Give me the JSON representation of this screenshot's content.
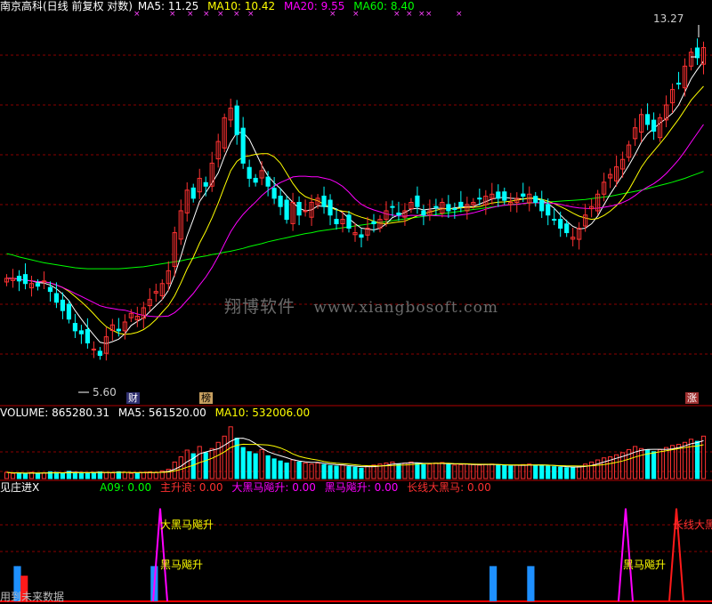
{
  "header": {
    "title": "南京高科(日线 前复权 对数)",
    "ma": [
      {
        "label": "MA5: 11.25",
        "color": "#ffffff"
      },
      {
        "label": "MA10: 10.42",
        "color": "#ffff00"
      },
      {
        "label": "MA20: 9.55",
        "color": "#ff00ff"
      },
      {
        "label": "MA60: 8.40",
        "color": "#00ff00"
      }
    ]
  },
  "volume_header": {
    "items": [
      {
        "label": "VOLUME: 865280.31",
        "color": "#ffffff"
      },
      {
        "label": "MA5: 561520.00",
        "color": "#ffffff"
      },
      {
        "label": "MA10: 532006.00",
        "color": "#ffff00"
      }
    ]
  },
  "indicator_header": {
    "name": "见庄进X",
    "items": [
      {
        "label": "A09: 0.00",
        "color": "#00ff00"
      },
      {
        "label": "主升浪: 0.00",
        "color": "#ff3030"
      },
      {
        "label": "大黑马飚升: 0.00",
        "color": "#ff00ff"
      },
      {
        "label": "黑马飚升: 0.00",
        "color": "#ff00ff"
      },
      {
        "label": "长线大黑马: 0.00",
        "color": "#ff3030"
      }
    ]
  },
  "annotations": {
    "price_high": "13.27",
    "price_low": "5.60",
    "tag_cai": "财",
    "tag_bang": "榜",
    "tag_zhang": "涨",
    "watermark_cn": "翔博软件",
    "watermark_url": "www.xiangbosoft.com",
    "sig_big_dark_horse": "大黑马飚升",
    "sig_dark_horse_left": "黑马飚升",
    "sig_dark_horse_right": "黑马飚升",
    "sig_long_dark_horse": "长线大黑",
    "footer_note": "用到未来数据"
  },
  "colors": {
    "up": "#ff3232",
    "down": "#00ffff",
    "ma5": "#ffffff",
    "ma10": "#ffff00",
    "ma20": "#ff00ff",
    "ma60": "#00ff00",
    "grid": "#8b0000",
    "bar_blue": "#1e90ff"
  },
  "chart_data": [
    {
      "type": "candlestick",
      "ylim": [
        5.0,
        14.5
      ],
      "log_scale": true,
      "closes": [
        6.95,
        6.95,
        6.9,
        6.85,
        6.85,
        6.8,
        6.9,
        6.7,
        6.5,
        6.35,
        6.2,
        6.0,
        5.95,
        5.8,
        5.7,
        5.6,
        5.9,
        6.1,
        6.0,
        6.15,
        6.3,
        6.25,
        6.4,
        6.55,
        6.7,
        6.85,
        7.1,
        7.9,
        8.4,
        8.9,
        8.7,
        9.2,
        9.0,
        9.6,
        10.2,
        10.9,
        11.2,
        10.4,
        9.6,
        9.2,
        9.1,
        9.4,
        9.0,
        8.7,
        8.5,
        8.2,
        8.6,
        8.3,
        8.4,
        8.6,
        8.7,
        8.5,
        8.3,
        8.1,
        8.2,
        8.0,
        7.9,
        7.8,
        8.0,
        8.1,
        8.2,
        8.4,
        8.5,
        8.3,
        8.4,
        8.6,
        8.5,
        8.3,
        8.4,
        8.5,
        8.6,
        8.4,
        8.45,
        8.5,
        8.55,
        8.6,
        8.7,
        8.75,
        8.8,
        8.7,
        8.65,
        8.6,
        8.7,
        8.75,
        8.8,
        8.6,
        8.4,
        8.3,
        8.2,
        8.0,
        7.9,
        7.8,
        8.0,
        8.3,
        8.5,
        8.8,
        9.1,
        9.3,
        9.5,
        9.7,
        10.1,
        10.6,
        11.0,
        10.7,
        10.5,
        10.9,
        11.3,
        11.8,
        12.0,
        12.6,
        13.1,
        12.9,
        13.27
      ],
      "series": [
        {
          "name": "MA5",
          "color": "#ffffff"
        },
        {
          "name": "MA10",
          "color": "#ffff00"
        },
        {
          "name": "MA20",
          "color": "#ff00ff"
        },
        {
          "name": "MA60",
          "color": "#00ff00"
        }
      ],
      "ma60_values": [
        7.45,
        7.42,
        7.38,
        7.35,
        7.32,
        7.29,
        7.26,
        7.24,
        7.22,
        7.2,
        7.18,
        7.16,
        7.15,
        7.14,
        7.14,
        7.14,
        7.14,
        7.14,
        7.14,
        7.15,
        7.16,
        7.17,
        7.18,
        7.2,
        7.22,
        7.24,
        7.26,
        7.28,
        7.3,
        7.33,
        7.35,
        7.38,
        7.4,
        7.43,
        7.45,
        7.48,
        7.5,
        7.53,
        7.56,
        7.6,
        7.63,
        7.66,
        7.7,
        7.73,
        7.76,
        7.79,
        7.82,
        7.85,
        7.88,
        7.9,
        7.93,
        7.95,
        7.97,
        7.99,
        8.01,
        8.03,
        8.05,
        8.07,
        8.09,
        8.11,
        8.13,
        8.15,
        8.17,
        8.19,
        8.21,
        8.23,
        8.25,
        8.27,
        8.29,
        8.31,
        8.33,
        8.35,
        8.37,
        8.39,
        8.41,
        8.43,
        8.45,
        8.47,
        8.49,
        8.51,
        8.53,
        8.55,
        8.56,
        8.57,
        8.58,
        8.59,
        8.6,
        8.61,
        8.62,
        8.63,
        8.64,
        8.65,
        8.66,
        8.67,
        8.69,
        8.71,
        8.73,
        8.75,
        8.78,
        8.81,
        8.84,
        8.87,
        8.9,
        8.94,
        8.98,
        9.02,
        9.06,
        9.1,
        9.15,
        9.2,
        9.26,
        9.32,
        9.38
      ]
    },
    {
      "type": "bar",
      "title": "VOLUME",
      "ylim": [
        0,
        1.1
      ],
      "values": [
        0.12,
        0.1,
        0.11,
        0.09,
        0.12,
        0.1,
        0.11,
        0.13,
        0.12,
        0.1,
        0.14,
        0.12,
        0.11,
        0.1,
        0.12,
        0.13,
        0.12,
        0.11,
        0.13,
        0.12,
        0.1,
        0.11,
        0.12,
        0.13,
        0.12,
        0.15,
        0.18,
        0.32,
        0.42,
        0.55,
        0.48,
        0.62,
        0.5,
        0.58,
        0.7,
        0.82,
        1.0,
        0.78,
        0.6,
        0.52,
        0.48,
        0.56,
        0.44,
        0.38,
        0.34,
        0.3,
        0.36,
        0.32,
        0.3,
        0.28,
        0.3,
        0.27,
        0.25,
        0.24,
        0.26,
        0.23,
        0.22,
        0.2,
        0.24,
        0.26,
        0.28,
        0.3,
        0.32,
        0.28,
        0.3,
        0.32,
        0.3,
        0.27,
        0.28,
        0.3,
        0.31,
        0.27,
        0.26,
        0.27,
        0.28,
        0.27,
        0.26,
        0.27,
        0.28,
        0.26,
        0.25,
        0.24,
        0.26,
        0.27,
        0.28,
        0.26,
        0.25,
        0.24,
        0.23,
        0.22,
        0.21,
        0.22,
        0.24,
        0.28,
        0.32,
        0.36,
        0.4,
        0.42,
        0.46,
        0.5,
        0.56,
        0.62,
        0.58,
        0.55,
        0.52,
        0.56,
        0.6,
        0.64,
        0.66,
        0.7,
        0.76,
        0.72,
        0.82
      ]
    },
    {
      "type": "bar",
      "title": "见庄进X",
      "ylim": [
        0,
        1.0
      ],
      "blue_bars": [
        {
          "i": 4,
          "h": 0.33
        },
        {
          "i": 5,
          "h": 0.33
        },
        {
          "i": 44,
          "h": 0.33
        },
        {
          "i": 45,
          "h": 0.33
        },
        {
          "i": 143,
          "h": 0.33
        },
        {
          "i": 144,
          "h": 0.33
        },
        {
          "i": 154,
          "h": 0.33
        },
        {
          "i": 155,
          "h": 0.33
        }
      ],
      "red_bars": [
        {
          "i": 6,
          "h": 0.24
        },
        {
          "i": 7,
          "h": 0.24
        }
      ],
      "spikes": [
        {
          "center": 180,
          "color": "#ff00ff",
          "h": 0.87
        },
        {
          "center": 703,
          "color": "#ff00ff",
          "h": 0.87
        },
        {
          "center": 760,
          "color": "#ff1a1a",
          "h": 0.87
        }
      ]
    }
  ]
}
